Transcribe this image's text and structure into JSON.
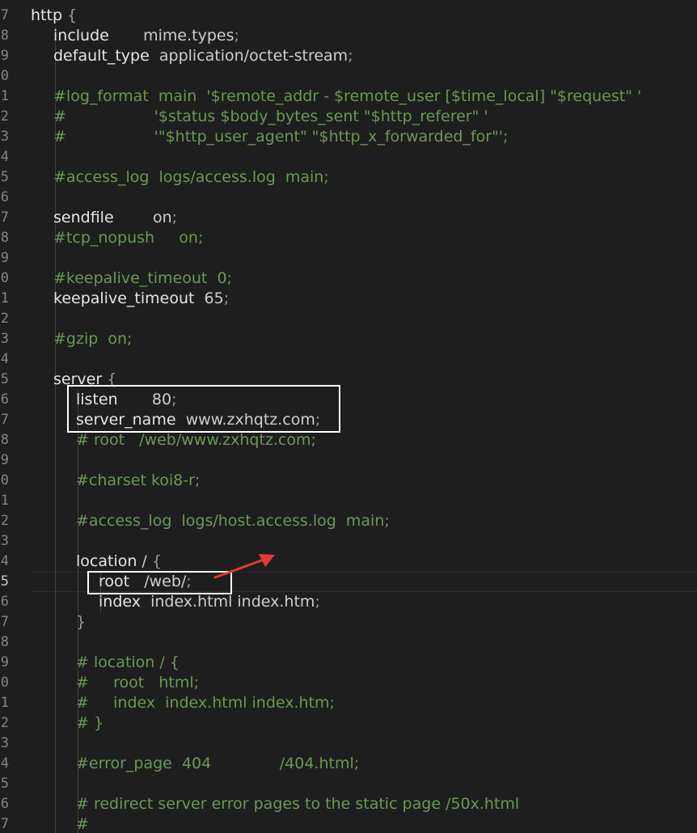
{
  "editor": {
    "theme_colors": {
      "background": "#1e1e1e",
      "keyword": "#e6e6e6",
      "comment": "#6a9955",
      "annotation_box": "#ffffff",
      "annotation_arrow": "#e53935"
    },
    "lines": [
      {
        "num": "7",
        "code": [
          {
            "t": "http",
            "c": "kw"
          },
          {
            "t": " {",
            "c": "punct"
          }
        ]
      },
      {
        "num": "8",
        "code": [
          {
            "t": "include",
            "c": "kw"
          },
          {
            "t": "       mime.types",
            "c": "val"
          },
          {
            "t": ";",
            "c": "punct"
          }
        ]
      },
      {
        "num": "9",
        "code": [
          {
            "t": "default_type",
            "c": "kw"
          },
          {
            "t": "  application/octet-stream",
            "c": "val"
          },
          {
            "t": ";",
            "c": "punct"
          }
        ]
      },
      {
        "num": "0",
        "code": []
      },
      {
        "num": "1",
        "code": [
          {
            "t": "#log_format  main  '$remote_addr - $remote_user [$time_local] \"$request\" '",
            "c": "cmt"
          }
        ]
      },
      {
        "num": "2",
        "code": [
          {
            "t": "#                  '$status $body_bytes_sent \"$http_referer\" '",
            "c": "cmt"
          }
        ]
      },
      {
        "num": "3",
        "code": [
          {
            "t": "#                  '\"$http_user_agent\" \"$http_x_forwarded_for\"';",
            "c": "cmt"
          }
        ]
      },
      {
        "num": "4",
        "code": []
      },
      {
        "num": "5",
        "code": [
          {
            "t": "#access_log  logs/access.log  main;",
            "c": "cmt"
          }
        ]
      },
      {
        "num": "6",
        "code": []
      },
      {
        "num": "7",
        "code": [
          {
            "t": "sendfile",
            "c": "kw"
          },
          {
            "t": "        on",
            "c": "val"
          },
          {
            "t": ";",
            "c": "punct"
          }
        ]
      },
      {
        "num": "8",
        "code": [
          {
            "t": "#tcp_nopush     on;",
            "c": "cmt"
          }
        ]
      },
      {
        "num": "9",
        "code": []
      },
      {
        "num": "0",
        "code": [
          {
            "t": "#keepalive_timeout  0;",
            "c": "cmt"
          }
        ]
      },
      {
        "num": "1",
        "code": [
          {
            "t": "keepalive_timeout",
            "c": "kw"
          },
          {
            "t": "  65",
            "c": "val"
          },
          {
            "t": ";",
            "c": "punct"
          }
        ]
      },
      {
        "num": "2",
        "code": []
      },
      {
        "num": "3",
        "code": [
          {
            "t": "#gzip  on;",
            "c": "cmt"
          }
        ]
      },
      {
        "num": "4",
        "code": []
      },
      {
        "num": "5",
        "code": [
          {
            "t": "server",
            "c": "kw"
          },
          {
            "t": " {",
            "c": "punct"
          }
        ]
      },
      {
        "num": "6",
        "code": [
          {
            "t": "listen",
            "c": "kw"
          },
          {
            "t": "       80",
            "c": "val"
          },
          {
            "t": ";",
            "c": "punct"
          }
        ]
      },
      {
        "num": "7",
        "code": [
          {
            "t": "server_name",
            "c": "kw"
          },
          {
            "t": "  www.zxhqtz.com",
            "c": "val"
          },
          {
            "t": ";",
            "c": "punct"
          }
        ]
      },
      {
        "num": "8",
        "code": [
          {
            "t": "# root   /web/www.zxhqtz.com;",
            "c": "cmt"
          }
        ]
      },
      {
        "num": "9",
        "code": []
      },
      {
        "num": "0",
        "code": [
          {
            "t": "#charset koi8-r;",
            "c": "cmt"
          }
        ]
      },
      {
        "num": "1",
        "code": []
      },
      {
        "num": "2",
        "code": [
          {
            "t": "#access_log  logs/host.access.log  main;",
            "c": "cmt"
          }
        ]
      },
      {
        "num": "3",
        "code": []
      },
      {
        "num": "4",
        "code": [
          {
            "t": "location",
            "c": "kw"
          },
          {
            "t": " / ",
            "c": "val"
          },
          {
            "t": "{",
            "c": "punct"
          }
        ]
      },
      {
        "num": "5",
        "code": [
          {
            "t": "root",
            "c": "kw"
          },
          {
            "t": "   /web/",
            "c": "val"
          },
          {
            "t": ";",
            "c": "punct"
          }
        ],
        "active": true
      },
      {
        "num": "6",
        "code": [
          {
            "t": "index",
            "c": "kw"
          },
          {
            "t": "  index.html index.htm",
            "c": "val"
          },
          {
            "t": ";",
            "c": "punct"
          }
        ]
      },
      {
        "num": "7",
        "code": [
          {
            "t": "}",
            "c": "punct"
          }
        ]
      },
      {
        "num": "8",
        "code": []
      },
      {
        "num": "9",
        "code": [
          {
            "t": "# location / {",
            "c": "cmt"
          }
        ]
      },
      {
        "num": "0",
        "code": [
          {
            "t": "#     root   html;",
            "c": "cmt"
          }
        ]
      },
      {
        "num": "1",
        "code": [
          {
            "t": "#     index  index.html index.htm;",
            "c": "cmt"
          }
        ]
      },
      {
        "num": "2",
        "code": [
          {
            "t": "# }",
            "c": "cmt"
          }
        ]
      },
      {
        "num": "3",
        "code": []
      },
      {
        "num": "4",
        "code": [
          {
            "t": "#error_page  404              /404.html;",
            "c": "cmt"
          }
        ]
      },
      {
        "num": "5",
        "code": []
      },
      {
        "num": "6",
        "code": [
          {
            "t": "# redirect server error pages to the static page /50x.html",
            "c": "cmt"
          }
        ]
      },
      {
        "num": "7",
        "code": [
          {
            "t": "#",
            "c": "cmt"
          }
        ]
      }
    ]
  }
}
